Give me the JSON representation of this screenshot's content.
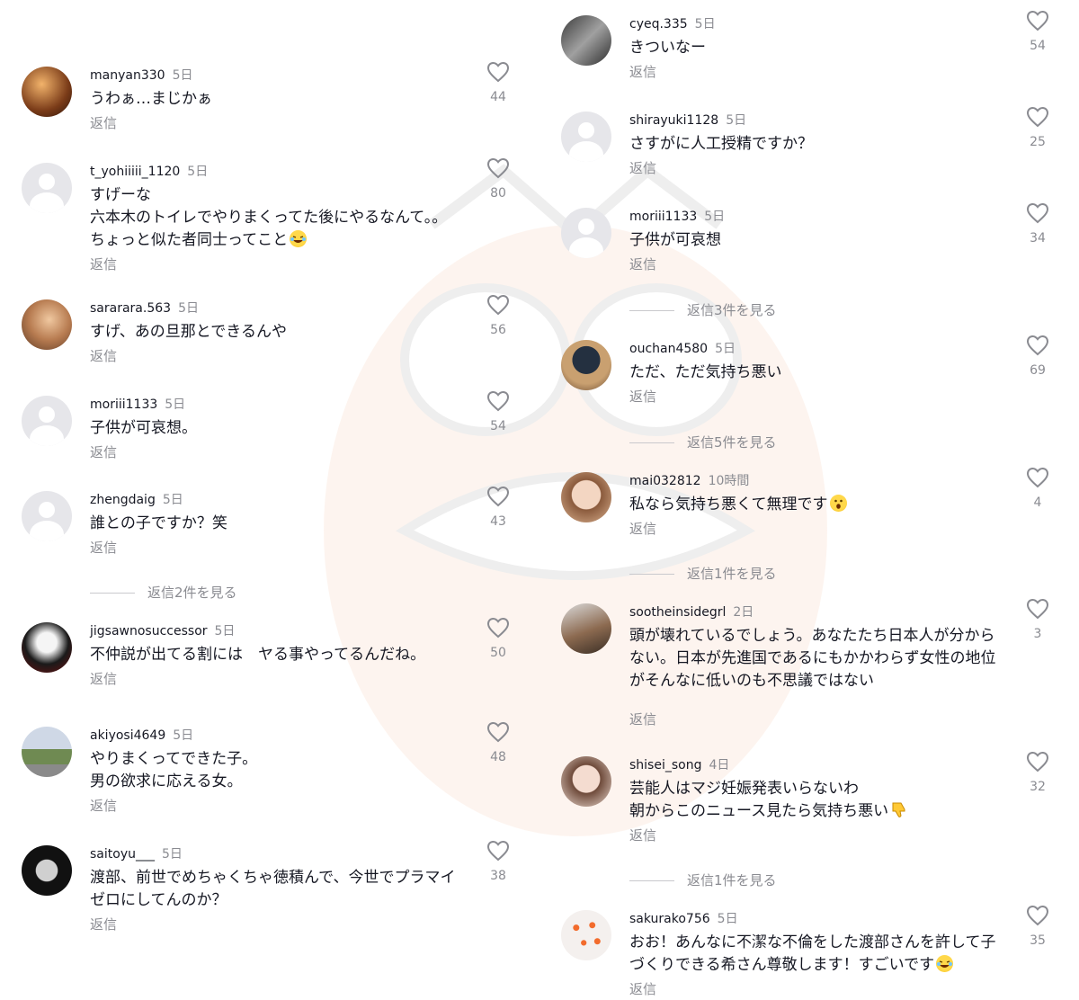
{
  "view_replies_prefix": "返信",
  "left_comments": [
    {
      "user": "manyan330",
      "time": "5日",
      "lines": [
        "うわぁ…まじかぁ"
      ],
      "reply": "返信",
      "likes": "44"
    },
    {
      "user": "t_yohiiiii_1120",
      "time": "5日",
      "lines": [
        "すげーな",
        "六本木のトイレでやりまくってた後にやるなんて。。",
        "ちょっと似た者同士ってこと"
      ],
      "reply": "返信",
      "likes": "80"
    },
    {
      "user": "sararara.563",
      "time": "5日",
      "lines": [
        "すげ、あの旦那とできるんや"
      ],
      "reply": "返信",
      "likes": "56"
    },
    {
      "user": "moriii1133",
      "time": "5日",
      "lines": [
        "子供が可哀想。"
      ],
      "reply": "返信",
      "likes": "54"
    },
    {
      "user": "zhengdaig",
      "time": "5日",
      "lines": [
        "誰との子ですか？笑"
      ],
      "reply": "返信",
      "likes": "43"
    },
    {
      "user": "jigsawnosuccessor",
      "time": "5日",
      "lines": [
        "不仲説が出てる割には　ヤる事やってるんだね。"
      ],
      "reply": "返信",
      "likes": "50"
    },
    {
      "user": "akiyosi4649",
      "time": "5日",
      "lines": [
        "やりまくってできた子。",
        "男の欲求に応える女。"
      ],
      "reply": "返信",
      "likes": "48"
    },
    {
      "user": "saitoyu___",
      "time": "5日",
      "lines": [
        "渡部、前世でめちゃくちゃ徳積んで、今世でプラマイ",
        "ゼロにしてんのか？"
      ],
      "reply": "返信",
      "likes": "38"
    }
  ],
  "left_view_replies": [
    "返信2件を見る"
  ],
  "right_comments": [
    {
      "user": "cyeq.335",
      "time": "5日",
      "lines": [
        "きついなー"
      ],
      "reply": "返信",
      "likes": "54"
    },
    {
      "user": "shirayuki1128",
      "time": "5日",
      "lines": [
        "さすがに人工授精ですか？"
      ],
      "reply": "返信",
      "likes": "25"
    },
    {
      "user": "moriii1133",
      "time": "5日",
      "lines": [
        "子供が可哀想"
      ],
      "reply": "返信",
      "likes": "34"
    },
    {
      "user": "ouchan4580",
      "time": "5日",
      "lines": [
        "ただ、ただ気持ち悪い"
      ],
      "reply": "返信",
      "likes": "69"
    },
    {
      "user": "mai032812",
      "time": "10時間",
      "lines": [
        "私なら気持ち悪くて無理です"
      ],
      "reply": "返信",
      "likes": "4"
    },
    {
      "user": "sootheinsidegrl",
      "time": "2日",
      "lines": [
        "頭が壊れているでしょう。あなたたち日本人が分から",
        "ない。日本が先進国であるにもかかわらず女性の地位",
        "がそんなに低いのも不思議ではない"
      ],
      "reply": "返信",
      "likes": "3"
    },
    {
      "user": "shisei_song",
      "time": "4日",
      "lines": [
        "芸能人はマジ妊娠発表いらないわ",
        "朝からこのニュース見たら気持ち悪い"
      ],
      "reply": "返信",
      "likes": "32"
    },
    {
      "user": "sakurako756",
      "time": "5日",
      "lines": [
        "おお！あんなに不潔な不倫をした渡部さんを許して子",
        "づくりできる希さん尊敬します！すごいです"
      ],
      "reply": "返信",
      "likes": "35"
    }
  ],
  "right_view_replies": [
    "返信3件を見る",
    "返信5件を見る",
    "返信1件を見る",
    "返信1件を見る"
  ]
}
